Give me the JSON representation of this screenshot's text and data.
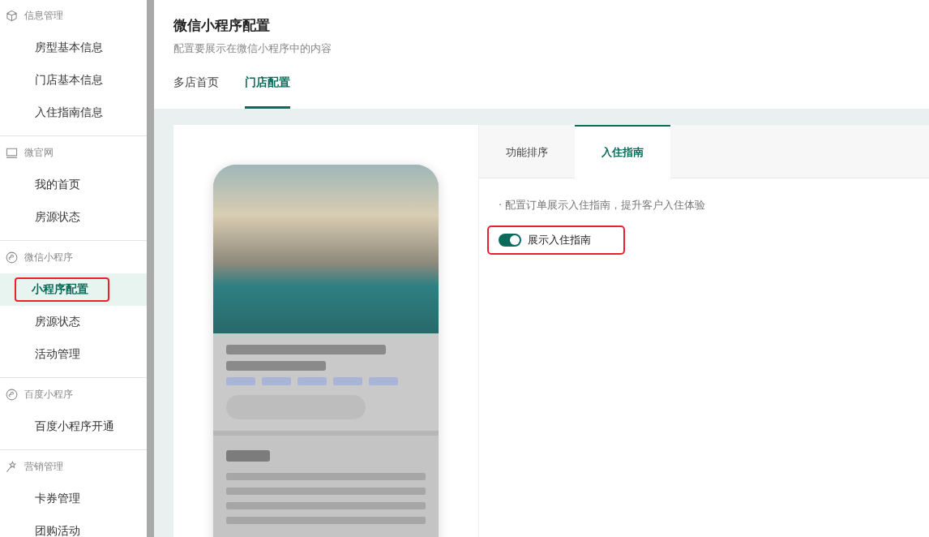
{
  "sidebar": {
    "groups": [
      {
        "title": "信息管理",
        "kind": "cube",
        "items": [
          {
            "label": "房型基本信息",
            "selected": false,
            "highlighted": false
          },
          {
            "label": "门店基本信息",
            "selected": false,
            "highlighted": false
          },
          {
            "label": "入住指南信息",
            "selected": false,
            "highlighted": false
          }
        ]
      },
      {
        "title": "微官网",
        "kind": "monitor",
        "items": [
          {
            "label": "我的首页",
            "selected": false,
            "highlighted": false
          },
          {
            "label": "房源状态",
            "selected": false,
            "highlighted": false
          }
        ]
      },
      {
        "title": "微信小程序",
        "kind": "miniapp",
        "items": [
          {
            "label": "小程序配置",
            "selected": true,
            "highlighted": true
          },
          {
            "label": "房源状态",
            "selected": false,
            "highlighted": false
          },
          {
            "label": "活动管理",
            "selected": false,
            "highlighted": false
          }
        ]
      },
      {
        "title": "百度小程序",
        "kind": "miniapp",
        "items": [
          {
            "label": "百度小程序开通",
            "selected": false,
            "highlighted": false
          }
        ]
      },
      {
        "title": "营销管理",
        "kind": "wand",
        "items": [
          {
            "label": "卡券管理",
            "selected": false,
            "highlighted": false
          },
          {
            "label": "团购活动",
            "selected": false,
            "highlighted": false
          }
        ]
      }
    ]
  },
  "header": {
    "title": "微信小程序配置",
    "subtitle": "配置要展示在微信小程序中的内容"
  },
  "tabs": [
    {
      "label": "多店首页",
      "selected": false
    },
    {
      "label": "门店配置",
      "selected": true
    }
  ],
  "config_panel": {
    "tabs": [
      {
        "label": "功能排序",
        "selected": false
      },
      {
        "label": "入住指南",
        "selected": true
      }
    ],
    "hint": "· 配置订单展示入住指南，提升客户入住体验",
    "toggle": {
      "label": "展示入住指南",
      "on": true,
      "highlighted": true
    }
  }
}
